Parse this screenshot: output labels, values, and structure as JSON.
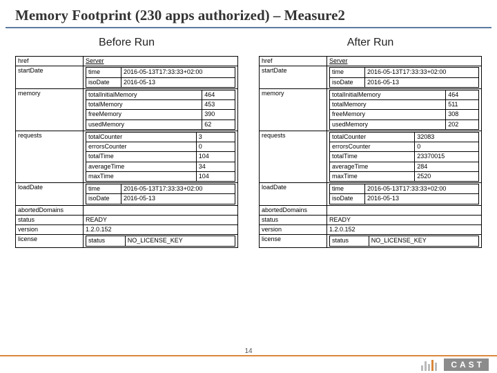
{
  "title": "Memory Footprint (230 apps authorized) – Measure2",
  "page_number": "14",
  "logo_text": "CAST",
  "before": {
    "heading": "Before Run",
    "href": {
      "label": "href",
      "value": "Server"
    },
    "startDate": {
      "label": "startDate",
      "time_label": "time",
      "time_value": "2016-05-13T17:33:33+02:00",
      "iso_label": "isoDate",
      "iso_value": "2016-05-13"
    },
    "memory": {
      "label": "memory",
      "rows": [
        {
          "k": "totalInitialMemory",
          "v": "464"
        },
        {
          "k": "totalMemory",
          "v": "453"
        },
        {
          "k": "freeMemory",
          "v": "390"
        },
        {
          "k": "usedMemory",
          "v": "62"
        }
      ]
    },
    "requests": {
      "label": "requests",
      "rows": [
        {
          "k": "totalCounter",
          "v": "3"
        },
        {
          "k": "errorsCounter",
          "v": "0"
        },
        {
          "k": "totalTime",
          "v": "104"
        },
        {
          "k": "averageTime",
          "v": "34"
        },
        {
          "k": "maxTime",
          "v": "104"
        }
      ]
    },
    "loadDate": {
      "label": "loadDate",
      "time_label": "time",
      "time_value": "2016-05-13T17:33:33+02:00",
      "iso_label": "isoDate",
      "iso_value": "2016-05-13"
    },
    "abortedDomains": {
      "label": "abortedDomains",
      "value": ""
    },
    "status": {
      "label": "status",
      "value": "READY"
    },
    "version": {
      "label": "version",
      "value": "1.2.0.152"
    },
    "license": {
      "label": "license",
      "status_label": "status",
      "status_value": "NO_LICENSE_KEY"
    }
  },
  "after": {
    "heading": "After Run",
    "href": {
      "label": "href",
      "value": "Server"
    },
    "startDate": {
      "label": "startDate",
      "time_label": "time",
      "time_value": "2016-05-13T17:33:33+02:00",
      "iso_label": "isoDate",
      "iso_value": "2016-05-13"
    },
    "memory": {
      "label": "memory",
      "rows": [
        {
          "k": "totalInitialMemory",
          "v": "464"
        },
        {
          "k": "totalMemory",
          "v": "511"
        },
        {
          "k": "freeMemory",
          "v": "308"
        },
        {
          "k": "usedMemory",
          "v": "202"
        }
      ]
    },
    "requests": {
      "label": "requests",
      "rows": [
        {
          "k": "totalCounter",
          "v": "32083"
        },
        {
          "k": "errorsCounter",
          "v": "0"
        },
        {
          "k": "totalTime",
          "v": "23370015"
        },
        {
          "k": "averageTime",
          "v": "284"
        },
        {
          "k": "maxTime",
          "v": "2520"
        }
      ]
    },
    "loadDate": {
      "label": "loadDate",
      "time_label": "time",
      "time_value": "2016-05-13T17:33:33+02:00",
      "iso_label": "isoDate",
      "iso_value": "2016-05-13"
    },
    "abortedDomains": {
      "label": "abortedDomains",
      "value": ""
    },
    "status": {
      "label": "status",
      "value": "READY"
    },
    "version": {
      "label": "version",
      "value": "1.2.0.152"
    },
    "license": {
      "label": "license",
      "status_label": "status",
      "status_value": "NO_LICENSE_KEY"
    }
  }
}
